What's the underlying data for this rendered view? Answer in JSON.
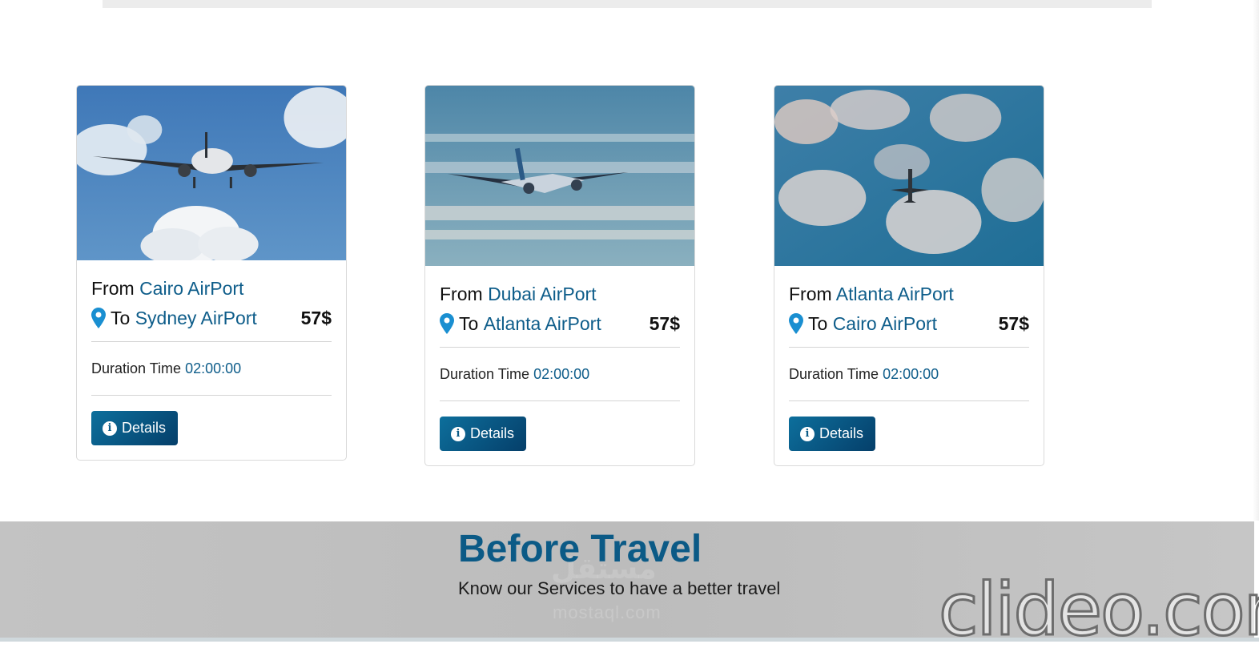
{
  "cards": [
    {
      "from_prefix": "From",
      "from": "Cairo AirPort",
      "to_prefix": "To",
      "to": "Sydney AirPort",
      "price": "57$",
      "duration_label": "Duration Time",
      "duration": "02:00:00",
      "button_label": "Details"
    },
    {
      "from_prefix": "From",
      "from": "Dubai AirPort",
      "to_prefix": "To",
      "to": "Atlanta AirPort",
      "price": "57$",
      "duration_label": "Duration Time",
      "duration": "02:00:00",
      "button_label": "Details"
    },
    {
      "from_prefix": "From",
      "from": "Atlanta AirPort",
      "to_prefix": "To",
      "to": "Cairo AirPort",
      "price": "57$",
      "duration_label": "Duration Time",
      "duration": "02:00:00",
      "button_label": "Details"
    }
  ],
  "section": {
    "title": "Before Travel",
    "subtitle": "Know our Services to have a better travel"
  },
  "watermarks": {
    "clideo": "clideo.com",
    "mostaql_ar": "مستقل",
    "mostaql": "mostaql.com"
  },
  "colors": {
    "accent": "#0e5d8a",
    "button": "#0b5c88",
    "section_bg": "#c0c0c0"
  },
  "icons": {
    "pin": "location-pin-icon",
    "info": "info-circle-icon"
  }
}
